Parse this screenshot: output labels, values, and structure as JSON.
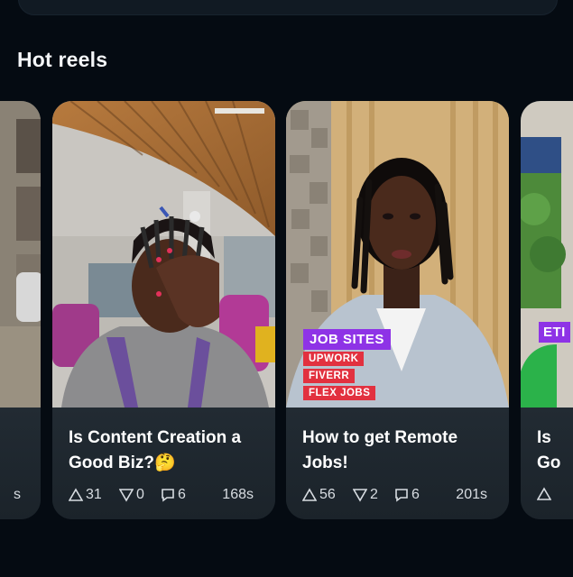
{
  "section": {
    "title": "Hot reels"
  },
  "reels": [
    {
      "title": "",
      "duration": "s",
      "upvotes": "",
      "downvotes": "",
      "comments": ""
    },
    {
      "title": "Is Content Creation a Good Biz?🤔",
      "upvotes": "31",
      "downvotes": "0",
      "comments": "6",
      "duration": "168s"
    },
    {
      "title": "How to get Remote Jobs!",
      "upvotes": "56",
      "downvotes": "2",
      "comments": "6",
      "duration": "201s",
      "overlay": {
        "heading": "JOB SITES",
        "items": [
          "UPWORK",
          "FIVERR",
          "FLEX JOBS"
        ]
      }
    },
    {
      "title": "Is Go",
      "overlay_tag": "ETI",
      "upvotes": "",
      "downvotes": "",
      "comments": ""
    }
  ],
  "colors": {
    "background": "#050b12",
    "card_info": "#1f2830",
    "tag_purple": "#8a2be2",
    "tag_red": "#e53935"
  },
  "icons": [
    "upvote-icon",
    "downvote-icon",
    "comment-icon"
  ]
}
